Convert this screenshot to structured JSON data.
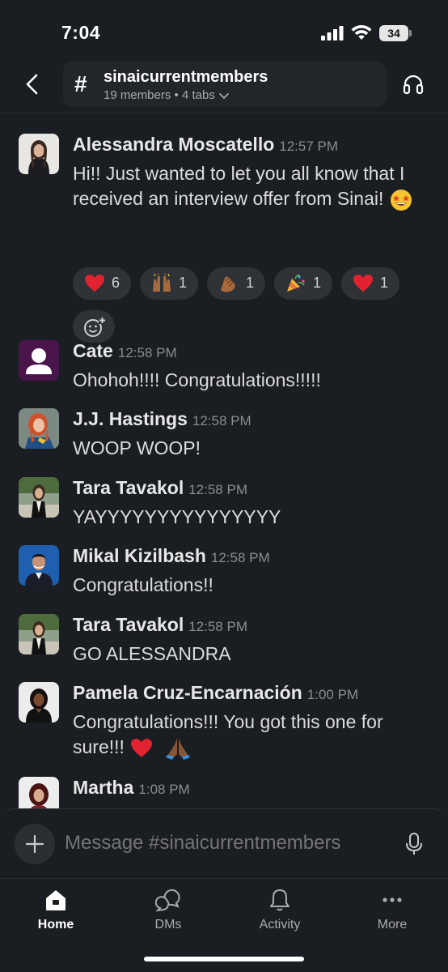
{
  "status_bar": {
    "time": "7:04",
    "battery": "34"
  },
  "header": {
    "channel_name": "sinaicurrentmembers",
    "channel_meta": "19 members • 4 tabs"
  },
  "messages": [
    {
      "author": "Alessandra Moscatello",
      "time": "12:57 PM",
      "text": "Hi!! Just wanted to let you all know that I received an interview offer from Sinai!",
      "trailing_emoji": "star-struck-emoji"
    },
    {
      "author": "Cate",
      "time": "12:58 PM",
      "text": "Ohohoh!!!! Congratulations!!!!!"
    },
    {
      "author": "J.J. Hastings",
      "time": "12:58 PM",
      "text": "WOOP WOOP!"
    },
    {
      "author": "Tara Tavakol",
      "time": "12:58 PM",
      "text": "YAYYYYYYYYYYYYYYY"
    },
    {
      "author": "Mikal Kizilbash",
      "time": "12:58 PM",
      "text": "Congratulations!!"
    },
    {
      "author": "Tara Tavakol",
      "time": "12:58 PM",
      "text": "GO ALESSANDRA"
    },
    {
      "author": "Pamela Cruz-Encarnación",
      "time": "1:00 PM",
      "text": "Congratulations!!! You got this one for sure!!!",
      "trailing_emoji": "heart-and-praying-hands-emoji"
    },
    {
      "author": "Martha",
      "time": "1:08 PM",
      "text": ""
    }
  ],
  "reactions": [
    {
      "emoji": "red-heart",
      "count": "6"
    },
    {
      "emoji": "raised-hands",
      "count": "1"
    },
    {
      "emoji": "clapping-hands",
      "count": "1"
    },
    {
      "emoji": "party-popper",
      "count": "1"
    },
    {
      "emoji": "red-heart",
      "count": "1"
    }
  ],
  "composer": {
    "placeholder": "Message #sinaicurrentmembers"
  },
  "tabs": [
    {
      "label": "Home",
      "icon": "home-icon",
      "active": true
    },
    {
      "label": "DMs",
      "icon": "dms-icon",
      "active": false
    },
    {
      "label": "Activity",
      "icon": "bell-icon",
      "active": false
    },
    {
      "label": "More",
      "icon": "more-icon",
      "active": false
    }
  ],
  "colors": {
    "background": "#1a1d21",
    "pill": "#222529",
    "reaction_bg": "#2f3236",
    "text": "#dcdcdd",
    "muted": "#8b8d90"
  }
}
